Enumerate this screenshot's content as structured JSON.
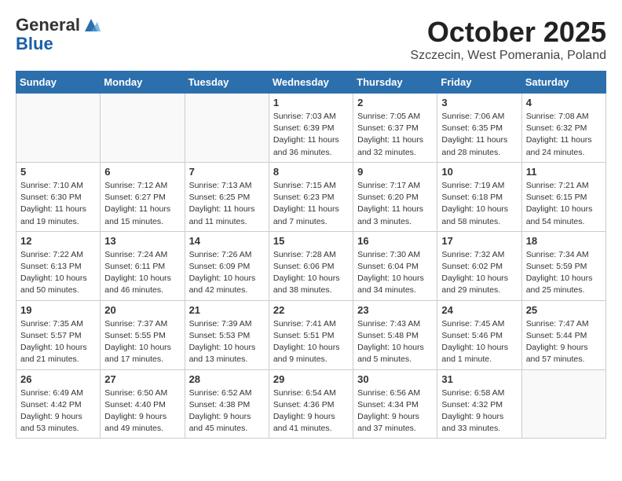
{
  "header": {
    "logo_line1": "General",
    "logo_line2": "Blue",
    "month": "October 2025",
    "location": "Szczecin, West Pomerania, Poland"
  },
  "weekdays": [
    "Sunday",
    "Monday",
    "Tuesday",
    "Wednesday",
    "Thursday",
    "Friday",
    "Saturday"
  ],
  "weeks": [
    [
      {
        "day": "",
        "info": ""
      },
      {
        "day": "",
        "info": ""
      },
      {
        "day": "",
        "info": ""
      },
      {
        "day": "1",
        "info": "Sunrise: 7:03 AM\nSunset: 6:39 PM\nDaylight: 11 hours\nand 36 minutes."
      },
      {
        "day": "2",
        "info": "Sunrise: 7:05 AM\nSunset: 6:37 PM\nDaylight: 11 hours\nand 32 minutes."
      },
      {
        "day": "3",
        "info": "Sunrise: 7:06 AM\nSunset: 6:35 PM\nDaylight: 11 hours\nand 28 minutes."
      },
      {
        "day": "4",
        "info": "Sunrise: 7:08 AM\nSunset: 6:32 PM\nDaylight: 11 hours\nand 24 minutes."
      }
    ],
    [
      {
        "day": "5",
        "info": "Sunrise: 7:10 AM\nSunset: 6:30 PM\nDaylight: 11 hours\nand 19 minutes."
      },
      {
        "day": "6",
        "info": "Sunrise: 7:12 AM\nSunset: 6:27 PM\nDaylight: 11 hours\nand 15 minutes."
      },
      {
        "day": "7",
        "info": "Sunrise: 7:13 AM\nSunset: 6:25 PM\nDaylight: 11 hours\nand 11 minutes."
      },
      {
        "day": "8",
        "info": "Sunrise: 7:15 AM\nSunset: 6:23 PM\nDaylight: 11 hours\nand 7 minutes."
      },
      {
        "day": "9",
        "info": "Sunrise: 7:17 AM\nSunset: 6:20 PM\nDaylight: 11 hours\nand 3 minutes."
      },
      {
        "day": "10",
        "info": "Sunrise: 7:19 AM\nSunset: 6:18 PM\nDaylight: 10 hours\nand 58 minutes."
      },
      {
        "day": "11",
        "info": "Sunrise: 7:21 AM\nSunset: 6:15 PM\nDaylight: 10 hours\nand 54 minutes."
      }
    ],
    [
      {
        "day": "12",
        "info": "Sunrise: 7:22 AM\nSunset: 6:13 PM\nDaylight: 10 hours\nand 50 minutes."
      },
      {
        "day": "13",
        "info": "Sunrise: 7:24 AM\nSunset: 6:11 PM\nDaylight: 10 hours\nand 46 minutes."
      },
      {
        "day": "14",
        "info": "Sunrise: 7:26 AM\nSunset: 6:09 PM\nDaylight: 10 hours\nand 42 minutes."
      },
      {
        "day": "15",
        "info": "Sunrise: 7:28 AM\nSunset: 6:06 PM\nDaylight: 10 hours\nand 38 minutes."
      },
      {
        "day": "16",
        "info": "Sunrise: 7:30 AM\nSunset: 6:04 PM\nDaylight: 10 hours\nand 34 minutes."
      },
      {
        "day": "17",
        "info": "Sunrise: 7:32 AM\nSunset: 6:02 PM\nDaylight: 10 hours\nand 29 minutes."
      },
      {
        "day": "18",
        "info": "Sunrise: 7:34 AM\nSunset: 5:59 PM\nDaylight: 10 hours\nand 25 minutes."
      }
    ],
    [
      {
        "day": "19",
        "info": "Sunrise: 7:35 AM\nSunset: 5:57 PM\nDaylight: 10 hours\nand 21 minutes."
      },
      {
        "day": "20",
        "info": "Sunrise: 7:37 AM\nSunset: 5:55 PM\nDaylight: 10 hours\nand 17 minutes."
      },
      {
        "day": "21",
        "info": "Sunrise: 7:39 AM\nSunset: 5:53 PM\nDaylight: 10 hours\nand 13 minutes."
      },
      {
        "day": "22",
        "info": "Sunrise: 7:41 AM\nSunset: 5:51 PM\nDaylight: 10 hours\nand 9 minutes."
      },
      {
        "day": "23",
        "info": "Sunrise: 7:43 AM\nSunset: 5:48 PM\nDaylight: 10 hours\nand 5 minutes."
      },
      {
        "day": "24",
        "info": "Sunrise: 7:45 AM\nSunset: 5:46 PM\nDaylight: 10 hours\nand 1 minute."
      },
      {
        "day": "25",
        "info": "Sunrise: 7:47 AM\nSunset: 5:44 PM\nDaylight: 9 hours\nand 57 minutes."
      }
    ],
    [
      {
        "day": "26",
        "info": "Sunrise: 6:49 AM\nSunset: 4:42 PM\nDaylight: 9 hours\nand 53 minutes."
      },
      {
        "day": "27",
        "info": "Sunrise: 6:50 AM\nSunset: 4:40 PM\nDaylight: 9 hours\nand 49 minutes."
      },
      {
        "day": "28",
        "info": "Sunrise: 6:52 AM\nSunset: 4:38 PM\nDaylight: 9 hours\nand 45 minutes."
      },
      {
        "day": "29",
        "info": "Sunrise: 6:54 AM\nSunset: 4:36 PM\nDaylight: 9 hours\nand 41 minutes."
      },
      {
        "day": "30",
        "info": "Sunrise: 6:56 AM\nSunset: 4:34 PM\nDaylight: 9 hours\nand 37 minutes."
      },
      {
        "day": "31",
        "info": "Sunrise: 6:58 AM\nSunset: 4:32 PM\nDaylight: 9 hours\nand 33 minutes."
      },
      {
        "day": "",
        "info": ""
      }
    ]
  ]
}
